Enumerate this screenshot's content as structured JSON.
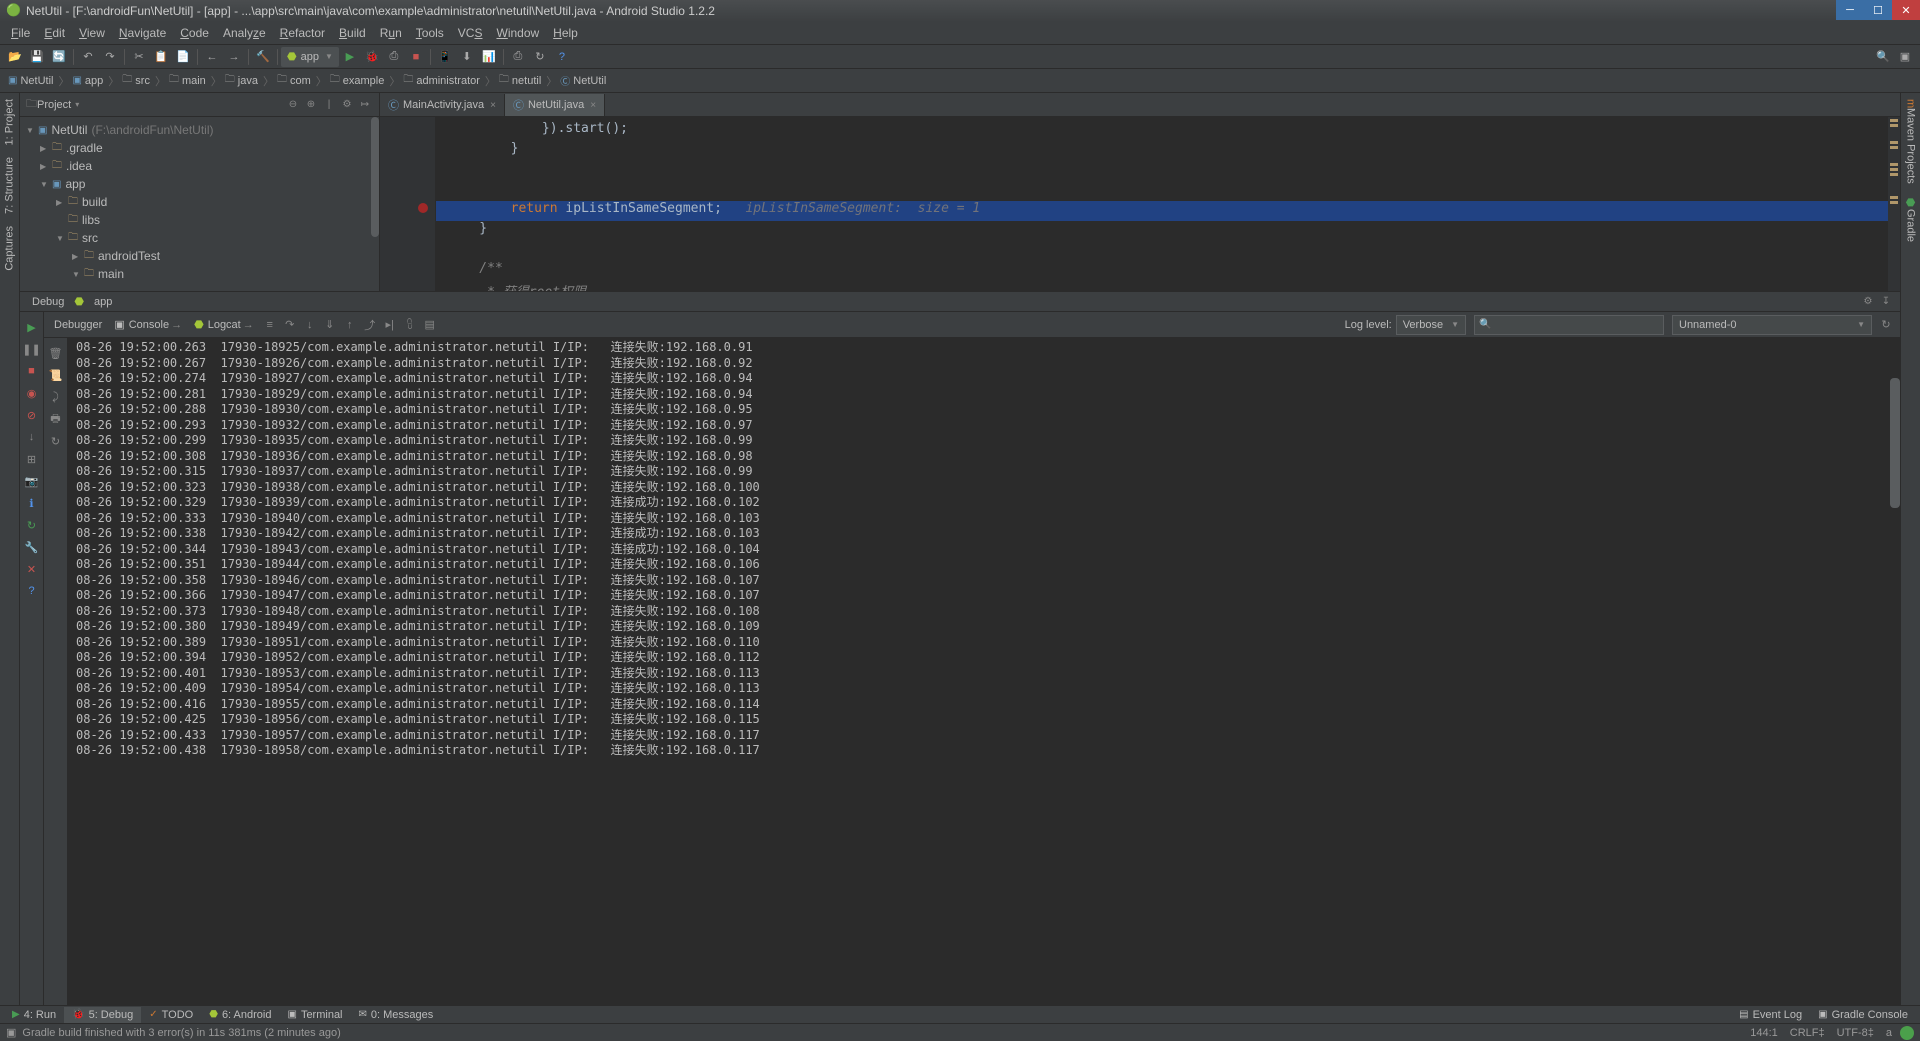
{
  "window": {
    "title": "NetUtil - [F:\\androidFun\\NetUtil] - [app] - ...\\app\\src\\main\\java\\com\\example\\administrator\\netutil\\NetUtil.java - Android Studio 1.2.2"
  },
  "menu": {
    "file": "File",
    "edit": "Edit",
    "view": "View",
    "navigate": "Navigate",
    "code": "Code",
    "analyze": "Analyze",
    "refactor": "Refactor",
    "build": "Build",
    "run": "Run",
    "tools": "Tools",
    "vcs": "VCS",
    "window": "Window",
    "help": "Help"
  },
  "run_config": {
    "label": "app"
  },
  "breadcrumb": {
    "items": [
      "NetUtil",
      "app",
      "src",
      "main",
      "java",
      "com",
      "example",
      "administrator",
      "netutil",
      "NetUtil"
    ]
  },
  "left_rail": {
    "project": "1: Project",
    "structure": "7: Structure",
    "captures": "Captures"
  },
  "right_rail": {
    "maven": "Maven Projects",
    "gradle": "Gradle"
  },
  "project": {
    "header": "Project",
    "root": {
      "name": "NetUtil",
      "path": "(F:\\androidFun\\NetUtil)"
    },
    "nodes": [
      {
        "label": ".gradle",
        "indent": 1,
        "arrow": "▶"
      },
      {
        "label": ".idea",
        "indent": 1,
        "arrow": "▶"
      },
      {
        "label": "app",
        "indent": 1,
        "arrow": "▼",
        "module": true
      },
      {
        "label": "build",
        "indent": 2,
        "arrow": "▶"
      },
      {
        "label": "libs",
        "indent": 2,
        "arrow": ""
      },
      {
        "label": "src",
        "indent": 2,
        "arrow": "▼"
      },
      {
        "label": "androidTest",
        "indent": 3,
        "arrow": "▶"
      },
      {
        "label": "main",
        "indent": 3,
        "arrow": "▼"
      }
    ]
  },
  "editor": {
    "tabs": [
      {
        "label": "MainActivity.java",
        "active": false
      },
      {
        "label": "NetUtil.java",
        "active": true
      }
    ],
    "lines": [
      {
        "text": "            }).start();",
        "type": "code"
      },
      {
        "text": "        }",
        "type": "code"
      },
      {
        "text": "",
        "type": "code"
      },
      {
        "text": "",
        "type": "code"
      },
      {
        "text": "        return ipListInSameSegment;",
        "hint": "ipListInSameSegment:  size = 1",
        "type": "return",
        "hl": true,
        "err": true
      },
      {
        "text": "    }",
        "type": "code"
      },
      {
        "text": "",
        "type": "code"
      },
      {
        "text": "    /**",
        "type": "comment"
      },
      {
        "text": "     * 获得root权限",
        "type": "comment"
      }
    ]
  },
  "debug": {
    "tab_label": "Debug",
    "app_label": "app",
    "subtabs": {
      "debugger": "Debugger",
      "console": "Console",
      "logcat": "Logcat"
    },
    "loglevel_label": "Log level:",
    "loglevel_value": "Verbose",
    "filter_value": "Unnamed-0"
  },
  "log": {
    "prefix_pid": "17930-",
    "prefix_pkg": "/com.example.administrator.netutil I/IP:",
    "fail": "连接失败:",
    "succ": "连接成功:",
    "lines": [
      {
        "t": "08-26 19:52:00.263",
        "tid": "18925",
        "s": "f",
        "ip": "192.168.0.91"
      },
      {
        "t": "08-26 19:52:00.267",
        "tid": "18926",
        "s": "f",
        "ip": "192.168.0.92"
      },
      {
        "t": "08-26 19:52:00.274",
        "tid": "18927",
        "s": "f",
        "ip": "192.168.0.94"
      },
      {
        "t": "08-26 19:52:00.281",
        "tid": "18929",
        "s": "f",
        "ip": "192.168.0.94"
      },
      {
        "t": "08-26 19:52:00.288",
        "tid": "18930",
        "s": "f",
        "ip": "192.168.0.95"
      },
      {
        "t": "08-26 19:52:00.293",
        "tid": "18932",
        "s": "f",
        "ip": "192.168.0.97"
      },
      {
        "t": "08-26 19:52:00.299",
        "tid": "18935",
        "s": "f",
        "ip": "192.168.0.99"
      },
      {
        "t": "08-26 19:52:00.308",
        "tid": "18936",
        "s": "f",
        "ip": "192.168.0.98"
      },
      {
        "t": "08-26 19:52:00.315",
        "tid": "18937",
        "s": "f",
        "ip": "192.168.0.99"
      },
      {
        "t": "08-26 19:52:00.323",
        "tid": "18938",
        "s": "f",
        "ip": "192.168.0.100"
      },
      {
        "t": "08-26 19:52:00.329",
        "tid": "18939",
        "s": "s",
        "ip": "192.168.0.102"
      },
      {
        "t": "08-26 19:52:00.333",
        "tid": "18940",
        "s": "f",
        "ip": "192.168.0.103"
      },
      {
        "t": "08-26 19:52:00.338",
        "tid": "18942",
        "s": "s",
        "ip": "192.168.0.103"
      },
      {
        "t": "08-26 19:52:00.344",
        "tid": "18943",
        "s": "s",
        "ip": "192.168.0.104"
      },
      {
        "t": "08-26 19:52:00.351",
        "tid": "18944",
        "s": "f",
        "ip": "192.168.0.106"
      },
      {
        "t": "08-26 19:52:00.358",
        "tid": "18946",
        "s": "f",
        "ip": "192.168.0.107"
      },
      {
        "t": "08-26 19:52:00.366",
        "tid": "18947",
        "s": "f",
        "ip": "192.168.0.107"
      },
      {
        "t": "08-26 19:52:00.373",
        "tid": "18948",
        "s": "f",
        "ip": "192.168.0.108"
      },
      {
        "t": "08-26 19:52:00.380",
        "tid": "18949",
        "s": "f",
        "ip": "192.168.0.109"
      },
      {
        "t": "08-26 19:52:00.389",
        "tid": "18951",
        "s": "f",
        "ip": "192.168.0.110"
      },
      {
        "t": "08-26 19:52:00.394",
        "tid": "18952",
        "s": "f",
        "ip": "192.168.0.112"
      },
      {
        "t": "08-26 19:52:00.401",
        "tid": "18953",
        "s": "f",
        "ip": "192.168.0.113"
      },
      {
        "t": "08-26 19:52:00.409",
        "tid": "18954",
        "s": "f",
        "ip": "192.168.0.113"
      },
      {
        "t": "08-26 19:52:00.416",
        "tid": "18955",
        "s": "f",
        "ip": "192.168.0.114"
      },
      {
        "t": "08-26 19:52:00.425",
        "tid": "18956",
        "s": "f",
        "ip": "192.168.0.115"
      },
      {
        "t": "08-26 19:52:00.433",
        "tid": "18957",
        "s": "f",
        "ip": "192.168.0.117"
      },
      {
        "t": "08-26 19:52:00.438",
        "tid": "18958",
        "s": "f",
        "ip": "192.168.0.117"
      }
    ]
  },
  "bottom_tabs": {
    "run": "4: Run",
    "debug": "5: Debug",
    "todo": "TODO",
    "android": "6: Android",
    "terminal": "Terminal",
    "messages": "0: Messages",
    "eventlog": "Event Log",
    "gradle_console": "Gradle Console"
  },
  "statusbar": {
    "msg": "Gradle build finished with 3 error(s) in 11s 381ms (2 minutes ago)",
    "pos": "144:1",
    "sep": "CRLF‡",
    "enc": "UTF-8‡",
    "lock": "a"
  }
}
